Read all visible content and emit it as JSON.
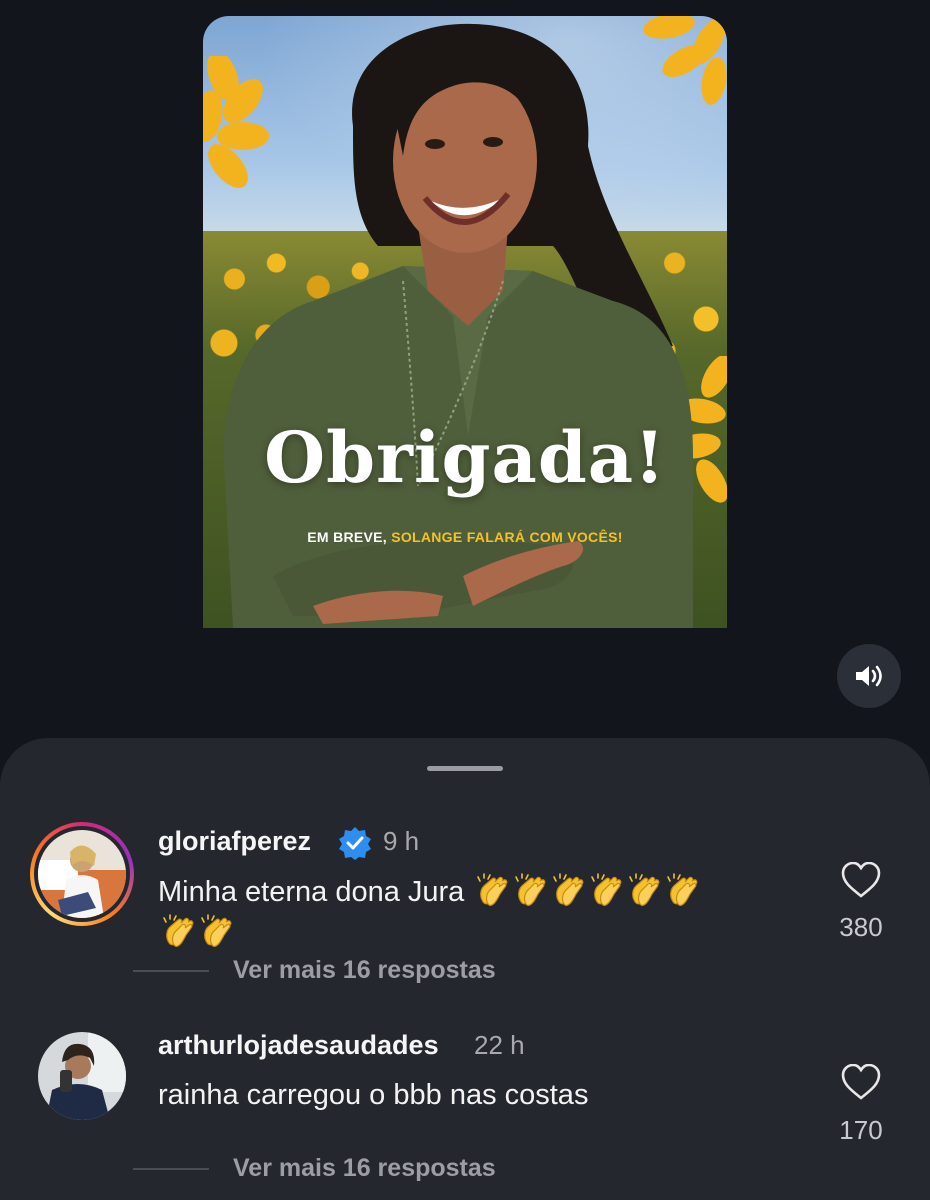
{
  "post": {
    "overlay_title": "Obrigada!",
    "overlay_sub_prefix": "EM BREVE, ",
    "overlay_sub_highlight": "SOLANGE FALARÁ COM VOCÊS!",
    "accent_color": "#f3c326"
  },
  "audio_button": {
    "icon": "speaker-icon"
  },
  "comments": [
    {
      "username": "gloriafperez",
      "verified": true,
      "time": "9 h",
      "text": "Minha eterna dona Jura",
      "emoji": "clapping-hands",
      "emoji_count": 8,
      "likes": "380",
      "replies": "Ver mais 16 respostas"
    },
    {
      "username": "arthurlojadesaudades",
      "verified": false,
      "time": "22 h",
      "text": "rainha carregou o bbb nas costas",
      "likes": "170",
      "replies": "Ver mais 16 respostas"
    }
  ]
}
